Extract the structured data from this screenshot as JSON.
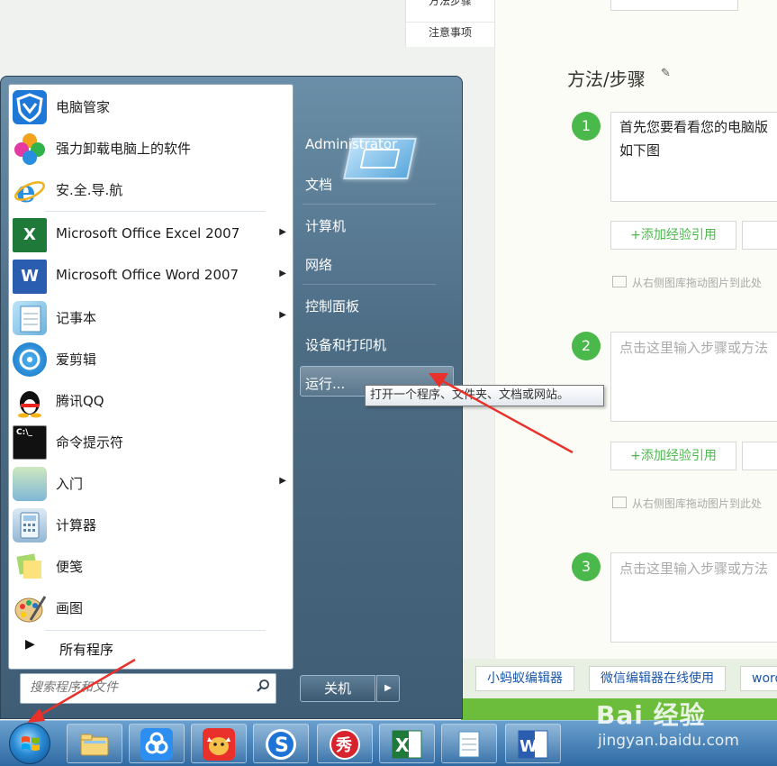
{
  "editor": {
    "nav_prev": "方法步骤",
    "nav_notes": "注意事项",
    "section_title": "方法/步骤",
    "steps": [
      {
        "num": "1",
        "line1": "首先您要看看您的电脑版",
        "line2": "如下图",
        "placeholder": false
      },
      {
        "num": "2",
        "line1": "点击这里输入步骤或方法",
        "line2": "",
        "placeholder": true
      },
      {
        "num": "3",
        "line1": "点击这里输入步骤或方法",
        "line2": "",
        "placeholder": true
      }
    ],
    "add_ref_label": "+添加经验引用",
    "drag_hint": "从右侧图库拖动图片到此处",
    "bottom_buttons": [
      "小蚂蚁编辑器",
      "微信编辑器在线使用",
      "word"
    ]
  },
  "start_menu": {
    "programs": [
      {
        "label": "电脑管家",
        "icon": "pc-manager-icon",
        "submenu": false
      },
      {
        "label": "强力卸载电脑上的软件",
        "icon": "uninstaller-icon",
        "submenu": false
      },
      {
        "label": "安.全.导.航",
        "icon": "ie-icon",
        "submenu": false
      },
      {
        "label": "Microsoft Office Excel 2007",
        "icon": "excel-icon",
        "submenu": true
      },
      {
        "label": "Microsoft Office Word 2007",
        "icon": "word-icon",
        "submenu": true
      },
      {
        "label": "记事本",
        "icon": "notepad-icon",
        "submenu": true
      },
      {
        "label": "爱剪辑",
        "icon": "video-editor-icon",
        "submenu": false
      },
      {
        "label": "腾讯QQ",
        "icon": "qq-icon",
        "submenu": false
      },
      {
        "label": "命令提示符",
        "icon": "cmd-icon",
        "submenu": false
      },
      {
        "label": "入门",
        "icon": "getting-started-icon",
        "submenu": true
      },
      {
        "label": "计算器",
        "icon": "calculator-icon",
        "submenu": false
      },
      {
        "label": "便笺",
        "icon": "sticky-notes-icon",
        "submenu": false
      },
      {
        "label": "画图",
        "icon": "paint-icon",
        "submenu": false
      }
    ],
    "all_programs": "所有程序",
    "search_placeholder": "搜索程序和文件",
    "right_items": {
      "user": "Administrator",
      "documents": "文档",
      "computer": "计算机",
      "network": "网络",
      "control_panel": "控制面板",
      "devices": "设备和打印机",
      "run": "运行..."
    },
    "shutdown": "关机",
    "tooltip": "打开一个程序、文件夹、文档或网站。"
  },
  "taskbar": {
    "apps": [
      "file-explorer-icon",
      "baidu-netdisk-icon",
      "dog-app-icon",
      "sogou-input-icon",
      "meitu-xiuxiu-icon",
      "excel-icon",
      "notepad-icon",
      "word-icon"
    ]
  },
  "watermark": {
    "brand": "Bai 经验",
    "url": "jingyan.baidu.com"
  },
  "colors": {
    "accent_green": "#4bb84b",
    "link_blue": "#1a55a8",
    "arrow_red": "#e8312b"
  }
}
